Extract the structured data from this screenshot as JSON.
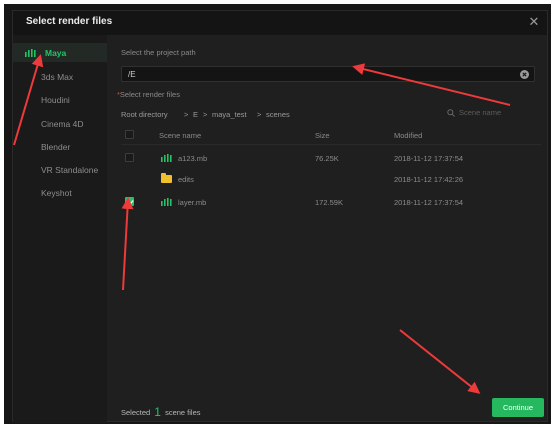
{
  "dialog": {
    "title": "Select render files"
  },
  "sidebar": {
    "items": [
      {
        "label": "Maya",
        "active": true
      },
      {
        "label": "3ds Max",
        "active": false
      },
      {
        "label": "Houdini",
        "active": false
      },
      {
        "label": "Cinema 4D",
        "active": false
      },
      {
        "label": "Blender",
        "active": false
      },
      {
        "label": "VR Standalone",
        "active": false
      },
      {
        "label": "Keyshot",
        "active": false
      }
    ]
  },
  "path": {
    "label": "Select the project path",
    "value": "/E"
  },
  "files": {
    "required_mark": "*",
    "label": "Select render files",
    "breadcrumb": [
      "Root directory",
      "E",
      "maya_test",
      "scenes"
    ],
    "breadcrumb_separator": ">",
    "search_placeholder": "Scene name",
    "columns": {
      "name": "Scene name",
      "size": "Size",
      "modified": "Modified"
    },
    "rows": [
      {
        "name": "a123.mb",
        "size": "76.25K",
        "modified": "2018-11-12 17:37:54",
        "type": "maya-file",
        "checked": false
      },
      {
        "name": "edits",
        "size": "",
        "modified": "2018-11-12 17:42:26",
        "type": "folder",
        "checked": false
      },
      {
        "name": "layer.mb",
        "size": "172.59K",
        "modified": "2018-11-12 17:37:54",
        "type": "maya-file",
        "checked": true
      }
    ]
  },
  "footer": {
    "prefix": "Selected",
    "count": "1",
    "suffix": "scene files",
    "continue_label": "Continue"
  },
  "colors": {
    "accent": "#26c266",
    "annotation_arrow": "#ee3a3a",
    "folder": "#f0c02c",
    "background": "#1f1f1f"
  },
  "icons": {
    "maya": "maya-logo-icon",
    "close": "close-icon",
    "clear": "clear-icon",
    "search": "search-icon",
    "folder": "folder-icon"
  }
}
